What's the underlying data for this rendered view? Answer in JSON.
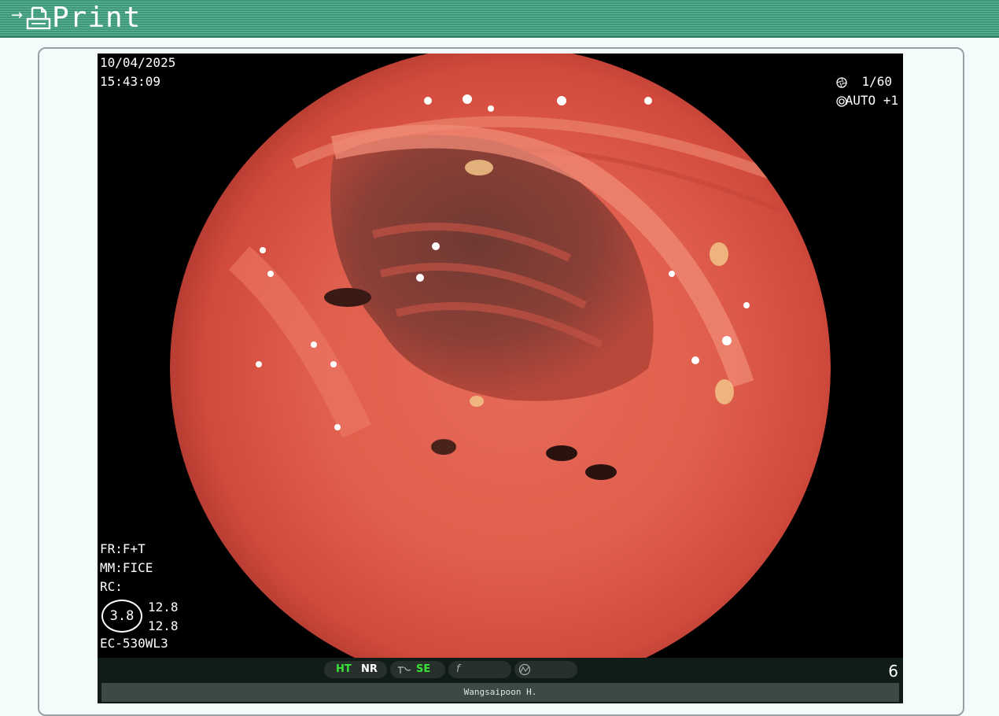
{
  "header": {
    "arrow_icon": "arrow-right-icon",
    "printer_icon": "printer-icon",
    "title": "Print",
    "color": "#4aa686"
  },
  "image": {
    "description_icon": "endoscopy-image",
    "date": "10/04/2025",
    "time": "15:43:09",
    "shutter": "1/60",
    "iris": "AUTO +1",
    "fr": "FR:F+T",
    "mm": "MM:FICE",
    "rc": "RC:",
    "zoom": "3.8",
    "value1": "12.8",
    "value2": "12.8",
    "scope": "EC-530WL3"
  },
  "status_bar": {
    "ht": "HT",
    "nr": "NR",
    "se": "SE",
    "pill3_symbol": "f",
    "page": "6",
    "operator": "Wangsaipoon H.",
    "accent": "#38e238"
  }
}
